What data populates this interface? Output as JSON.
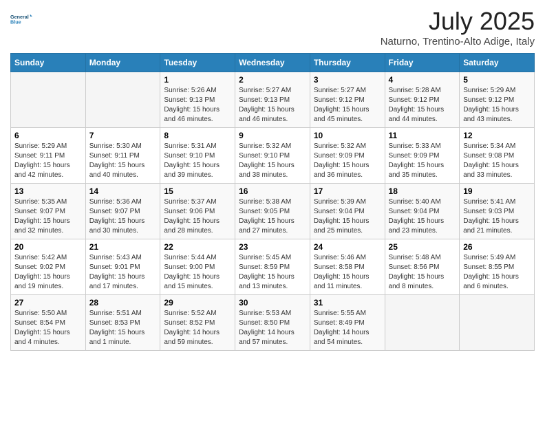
{
  "header": {
    "logo_general": "General",
    "logo_blue": "Blue",
    "month_title": "July 2025",
    "subtitle": "Naturno, Trentino-Alto Adige, Italy"
  },
  "weekdays": [
    "Sunday",
    "Monday",
    "Tuesday",
    "Wednesday",
    "Thursday",
    "Friday",
    "Saturday"
  ],
  "weeks": [
    [
      {
        "day": "",
        "sunrise": "",
        "sunset": "",
        "daylight": ""
      },
      {
        "day": "",
        "sunrise": "",
        "sunset": "",
        "daylight": ""
      },
      {
        "day": "1",
        "sunrise": "Sunrise: 5:26 AM",
        "sunset": "Sunset: 9:13 PM",
        "daylight": "Daylight: 15 hours and 46 minutes."
      },
      {
        "day": "2",
        "sunrise": "Sunrise: 5:27 AM",
        "sunset": "Sunset: 9:13 PM",
        "daylight": "Daylight: 15 hours and 46 minutes."
      },
      {
        "day": "3",
        "sunrise": "Sunrise: 5:27 AM",
        "sunset": "Sunset: 9:12 PM",
        "daylight": "Daylight: 15 hours and 45 minutes."
      },
      {
        "day": "4",
        "sunrise": "Sunrise: 5:28 AM",
        "sunset": "Sunset: 9:12 PM",
        "daylight": "Daylight: 15 hours and 44 minutes."
      },
      {
        "day": "5",
        "sunrise": "Sunrise: 5:29 AM",
        "sunset": "Sunset: 9:12 PM",
        "daylight": "Daylight: 15 hours and 43 minutes."
      }
    ],
    [
      {
        "day": "6",
        "sunrise": "Sunrise: 5:29 AM",
        "sunset": "Sunset: 9:11 PM",
        "daylight": "Daylight: 15 hours and 42 minutes."
      },
      {
        "day": "7",
        "sunrise": "Sunrise: 5:30 AM",
        "sunset": "Sunset: 9:11 PM",
        "daylight": "Daylight: 15 hours and 40 minutes."
      },
      {
        "day": "8",
        "sunrise": "Sunrise: 5:31 AM",
        "sunset": "Sunset: 9:10 PM",
        "daylight": "Daylight: 15 hours and 39 minutes."
      },
      {
        "day": "9",
        "sunrise": "Sunrise: 5:32 AM",
        "sunset": "Sunset: 9:10 PM",
        "daylight": "Daylight: 15 hours and 38 minutes."
      },
      {
        "day": "10",
        "sunrise": "Sunrise: 5:32 AM",
        "sunset": "Sunset: 9:09 PM",
        "daylight": "Daylight: 15 hours and 36 minutes."
      },
      {
        "day": "11",
        "sunrise": "Sunrise: 5:33 AM",
        "sunset": "Sunset: 9:09 PM",
        "daylight": "Daylight: 15 hours and 35 minutes."
      },
      {
        "day": "12",
        "sunrise": "Sunrise: 5:34 AM",
        "sunset": "Sunset: 9:08 PM",
        "daylight": "Daylight: 15 hours and 33 minutes."
      }
    ],
    [
      {
        "day": "13",
        "sunrise": "Sunrise: 5:35 AM",
        "sunset": "Sunset: 9:07 PM",
        "daylight": "Daylight: 15 hours and 32 minutes."
      },
      {
        "day": "14",
        "sunrise": "Sunrise: 5:36 AM",
        "sunset": "Sunset: 9:07 PM",
        "daylight": "Daylight: 15 hours and 30 minutes."
      },
      {
        "day": "15",
        "sunrise": "Sunrise: 5:37 AM",
        "sunset": "Sunset: 9:06 PM",
        "daylight": "Daylight: 15 hours and 28 minutes."
      },
      {
        "day": "16",
        "sunrise": "Sunrise: 5:38 AM",
        "sunset": "Sunset: 9:05 PM",
        "daylight": "Daylight: 15 hours and 27 minutes."
      },
      {
        "day": "17",
        "sunrise": "Sunrise: 5:39 AM",
        "sunset": "Sunset: 9:04 PM",
        "daylight": "Daylight: 15 hours and 25 minutes."
      },
      {
        "day": "18",
        "sunrise": "Sunrise: 5:40 AM",
        "sunset": "Sunset: 9:04 PM",
        "daylight": "Daylight: 15 hours and 23 minutes."
      },
      {
        "day": "19",
        "sunrise": "Sunrise: 5:41 AM",
        "sunset": "Sunset: 9:03 PM",
        "daylight": "Daylight: 15 hours and 21 minutes."
      }
    ],
    [
      {
        "day": "20",
        "sunrise": "Sunrise: 5:42 AM",
        "sunset": "Sunset: 9:02 PM",
        "daylight": "Daylight: 15 hours and 19 minutes."
      },
      {
        "day": "21",
        "sunrise": "Sunrise: 5:43 AM",
        "sunset": "Sunset: 9:01 PM",
        "daylight": "Daylight: 15 hours and 17 minutes."
      },
      {
        "day": "22",
        "sunrise": "Sunrise: 5:44 AM",
        "sunset": "Sunset: 9:00 PM",
        "daylight": "Daylight: 15 hours and 15 minutes."
      },
      {
        "day": "23",
        "sunrise": "Sunrise: 5:45 AM",
        "sunset": "Sunset: 8:59 PM",
        "daylight": "Daylight: 15 hours and 13 minutes."
      },
      {
        "day": "24",
        "sunrise": "Sunrise: 5:46 AM",
        "sunset": "Sunset: 8:58 PM",
        "daylight": "Daylight: 15 hours and 11 minutes."
      },
      {
        "day": "25",
        "sunrise": "Sunrise: 5:48 AM",
        "sunset": "Sunset: 8:56 PM",
        "daylight": "Daylight: 15 hours and 8 minutes."
      },
      {
        "day": "26",
        "sunrise": "Sunrise: 5:49 AM",
        "sunset": "Sunset: 8:55 PM",
        "daylight": "Daylight: 15 hours and 6 minutes."
      }
    ],
    [
      {
        "day": "27",
        "sunrise": "Sunrise: 5:50 AM",
        "sunset": "Sunset: 8:54 PM",
        "daylight": "Daylight: 15 hours and 4 minutes."
      },
      {
        "day": "28",
        "sunrise": "Sunrise: 5:51 AM",
        "sunset": "Sunset: 8:53 PM",
        "daylight": "Daylight: 15 hours and 1 minute."
      },
      {
        "day": "29",
        "sunrise": "Sunrise: 5:52 AM",
        "sunset": "Sunset: 8:52 PM",
        "daylight": "Daylight: 14 hours and 59 minutes."
      },
      {
        "day": "30",
        "sunrise": "Sunrise: 5:53 AM",
        "sunset": "Sunset: 8:50 PM",
        "daylight": "Daylight: 14 hours and 57 minutes."
      },
      {
        "day": "31",
        "sunrise": "Sunrise: 5:55 AM",
        "sunset": "Sunset: 8:49 PM",
        "daylight": "Daylight: 14 hours and 54 minutes."
      },
      {
        "day": "",
        "sunrise": "",
        "sunset": "",
        "daylight": ""
      },
      {
        "day": "",
        "sunrise": "",
        "sunset": "",
        "daylight": ""
      }
    ]
  ]
}
